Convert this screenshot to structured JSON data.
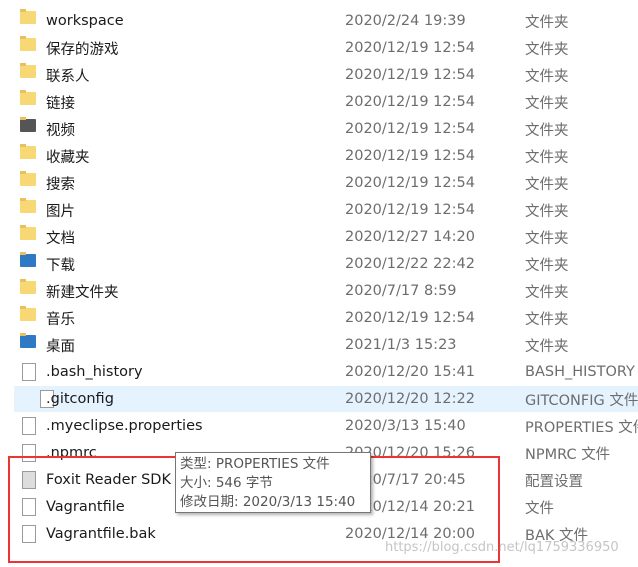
{
  "files": [
    {
      "name": "workspace",
      "date": "2020/2/24 19:39",
      "type": "文件夹",
      "icon": "folder-icon"
    },
    {
      "name": "保存的游戏",
      "date": "2020/12/19 12:54",
      "type": "文件夹",
      "icon": "saved-games-folder-icon"
    },
    {
      "name": "联系人",
      "date": "2020/12/19 12:54",
      "type": "文件夹",
      "icon": "contacts-folder-icon"
    },
    {
      "name": "链接",
      "date": "2020/12/19 12:54",
      "type": "文件夹",
      "icon": "links-folder-icon"
    },
    {
      "name": "视频",
      "date": "2020/12/19 12:54",
      "type": "文件夹",
      "icon": "videos-folder-icon"
    },
    {
      "name": "收藏夹",
      "date": "2020/12/19 12:54",
      "type": "文件夹",
      "icon": "favorites-folder-icon"
    },
    {
      "name": "搜索",
      "date": "2020/12/19 12:54",
      "type": "文件夹",
      "icon": "searches-folder-icon"
    },
    {
      "name": "图片",
      "date": "2020/12/19 12:54",
      "type": "文件夹",
      "icon": "pictures-folder-icon"
    },
    {
      "name": "文档",
      "date": "2020/12/27 14:20",
      "type": "文件夹",
      "icon": "documents-folder-icon"
    },
    {
      "name": "下载",
      "date": "2020/12/22 22:42",
      "type": "文件夹",
      "icon": "downloads-folder-icon"
    },
    {
      "name": "新建文件夹",
      "date": "2020/7/17 8:59",
      "type": "文件夹",
      "icon": "folder-icon"
    },
    {
      "name": "音乐",
      "date": "2020/12/19 12:54",
      "type": "文件夹",
      "icon": "music-folder-icon"
    },
    {
      "name": "桌面",
      "date": "2021/1/3 15:23",
      "type": "文件夹",
      "icon": "desktop-folder-icon"
    },
    {
      "name": ".bash_history",
      "date": "2020/12/20 15:41",
      "type": "BASH_HISTORY",
      "icon": "file-icon"
    },
    {
      "name": ".gitconfig",
      "date": "2020/12/20 12:22",
      "type": "GITCONFIG 文件",
      "icon": "file-icon",
      "selected": true
    },
    {
      "name": ".myeclipse.properties",
      "date": "2020/3/13 15:40",
      "type": "PROPERTIES 文件",
      "icon": "file-icon"
    },
    {
      "name": ".npmrc",
      "date": "2020/12/20 15:26",
      "type": "NPMRC 文件",
      "icon": "file-icon"
    },
    {
      "name": "Foxit Reader SDK",
      "date": "2020/7/17 20:45",
      "type": "配置设置",
      "icon": "settings-file-icon"
    },
    {
      "name": "Vagrantfile",
      "date": "2020/12/14 20:21",
      "type": "文件",
      "icon": "file-icon"
    },
    {
      "name": "Vagrantfile.bak",
      "date": "2020/12/14 20:00",
      "type": "BAK 文件",
      "icon": "file-icon"
    }
  ],
  "tooltip": {
    "type_line": "类型: PROPERTIES 文件",
    "size_line": "大小: 546 字节",
    "modified_line": "修改日期: 2020/3/13 15:40"
  },
  "watermark": "https://blog.csdn.net/lq1759336950",
  "colors": {
    "selection": "#e5f3ff",
    "highlight_box": "#ee3333",
    "folder": "#f8d775"
  }
}
